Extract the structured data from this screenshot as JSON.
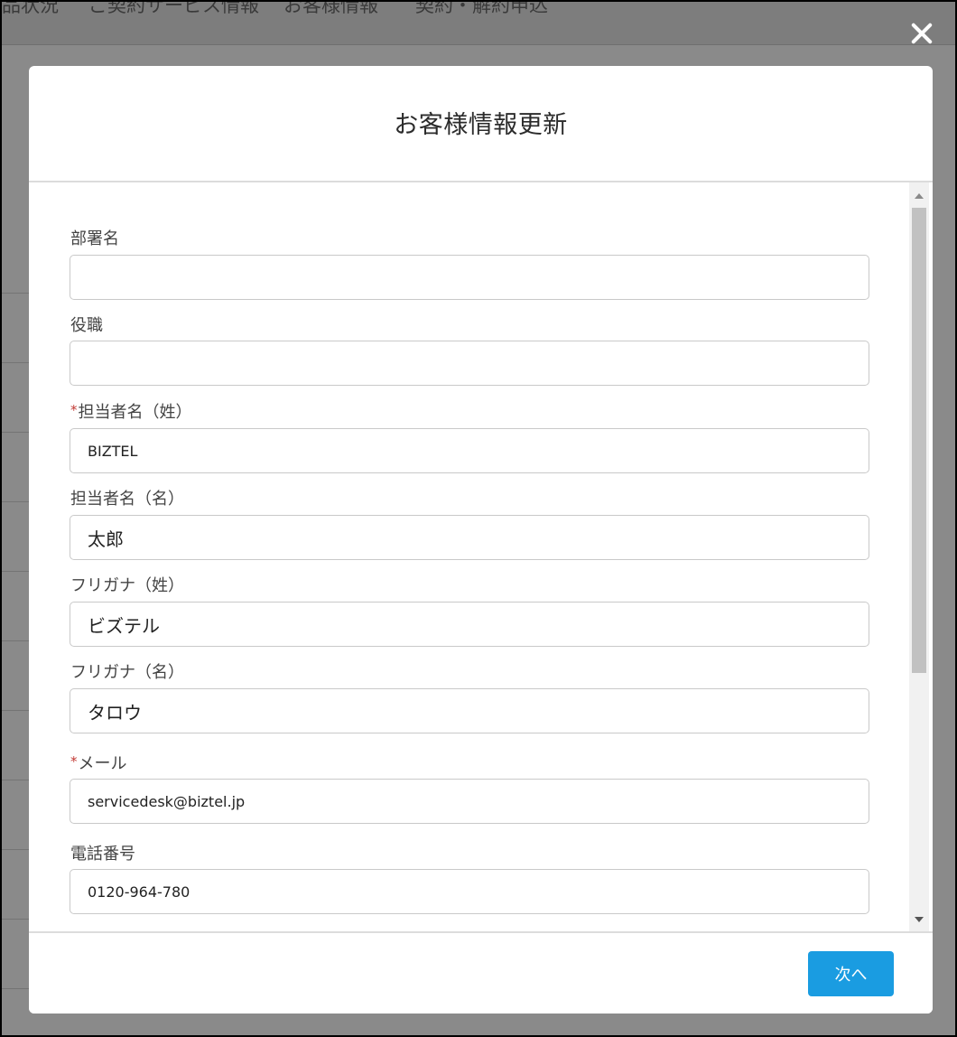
{
  "background": {
    "nav_items": [
      "品状況",
      "ご契約サービス情報",
      "お客様情報",
      "契約・解約申込"
    ]
  },
  "modal": {
    "title": "お客様情報更新",
    "fields": [
      {
        "label": "部署名",
        "required": false,
        "value": ""
      },
      {
        "label": "役職",
        "required": false,
        "value": ""
      },
      {
        "label": "担当者名（姓）",
        "required": true,
        "value": "BIZTEL"
      },
      {
        "label": "担当者名（名）",
        "required": false,
        "value": "太郎"
      },
      {
        "label": "フリガナ（姓）",
        "required": false,
        "value": "ビズテル"
      },
      {
        "label": "フリガナ（名）",
        "required": false,
        "value": "タロウ"
      },
      {
        "label": "メール",
        "required": true,
        "value": "servicedesk@biztel.jp"
      },
      {
        "label": "電話番号",
        "required": false,
        "value": "0120-964-780"
      }
    ],
    "required_mark": "*",
    "next_label": "次へ"
  },
  "colors": {
    "primary_button": "#1a9ce1",
    "required_mark": "#c23934",
    "overlay": "#8a8a8a"
  }
}
